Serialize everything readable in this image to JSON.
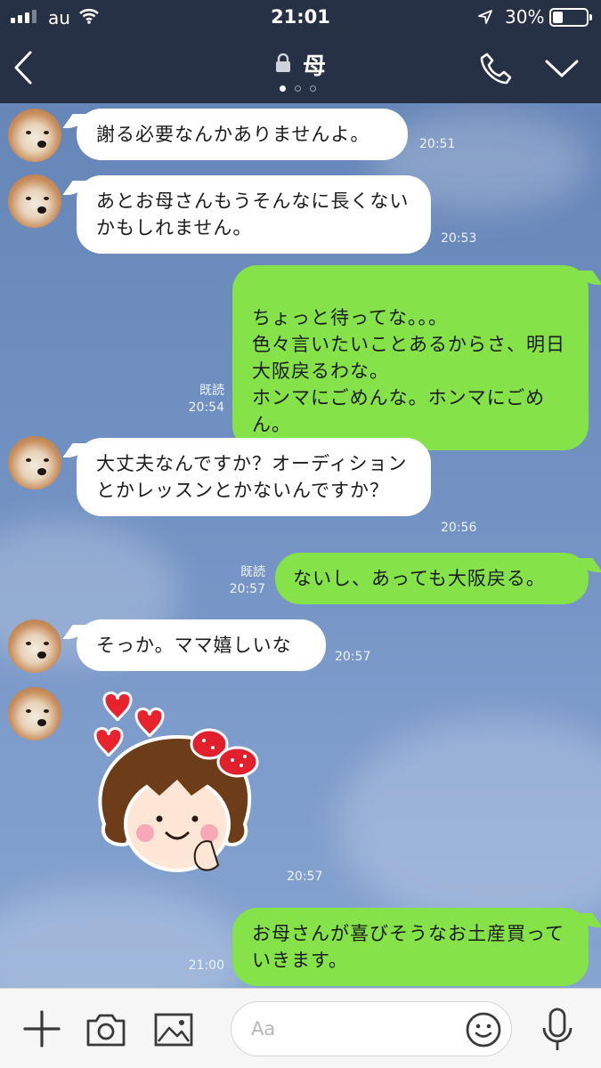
{
  "status_bar": {
    "carrier": "au",
    "time": "21:01",
    "battery": "30%",
    "battery_level": 0.3
  },
  "header": {
    "title": "母",
    "page_count": 3,
    "page_active": 1
  },
  "messages": [
    {
      "from": "them",
      "text": "謝る必要なんかありませんよ。",
      "time": "20:51"
    },
    {
      "from": "them",
      "text": "あとお母さんもうそんなに長くないかもしれません。",
      "time": "20:53"
    },
    {
      "from": "me",
      "text": "ちょっと待ってな。。。\n色々言いたいことあるからさ、明日大阪戻るわな。\nホンマにごめんな。ホンマにごめん。",
      "read": "既読",
      "time": "20:54"
    },
    {
      "from": "them",
      "text": "大丈夫なんですか？オーディションとかレッスンとかないんですか？",
      "time": "20:56"
    },
    {
      "from": "me",
      "text": "ないし、あっても大阪戻る。",
      "read": "既読",
      "time": "20:57"
    },
    {
      "from": "them",
      "text": "そっか。ママ嬉しいな",
      "time": "20:57"
    },
    {
      "from": "them",
      "type": "sticker",
      "sticker": "girl-with-hearts-sticker",
      "time": "20:57"
    },
    {
      "from": "me",
      "text": "お母さんが喜びそうなお土産買っていきます。",
      "time": "21:00"
    }
  ],
  "input": {
    "placeholder": "Aa"
  },
  "icons": {
    "back": "chevron-left-icon",
    "lock": "lock-icon",
    "call": "phone-icon",
    "menu": "chevron-down-icon",
    "plus": "plus-icon",
    "camera": "camera-icon",
    "image": "image-icon",
    "emoji": "smiley-icon",
    "mic": "microphone-icon"
  },
  "colors": {
    "header_bg": "#273146",
    "chat_bg": "#7292c3",
    "outgoing_bubble": "#85e249",
    "incoming_bubble": "#ffffff"
  }
}
